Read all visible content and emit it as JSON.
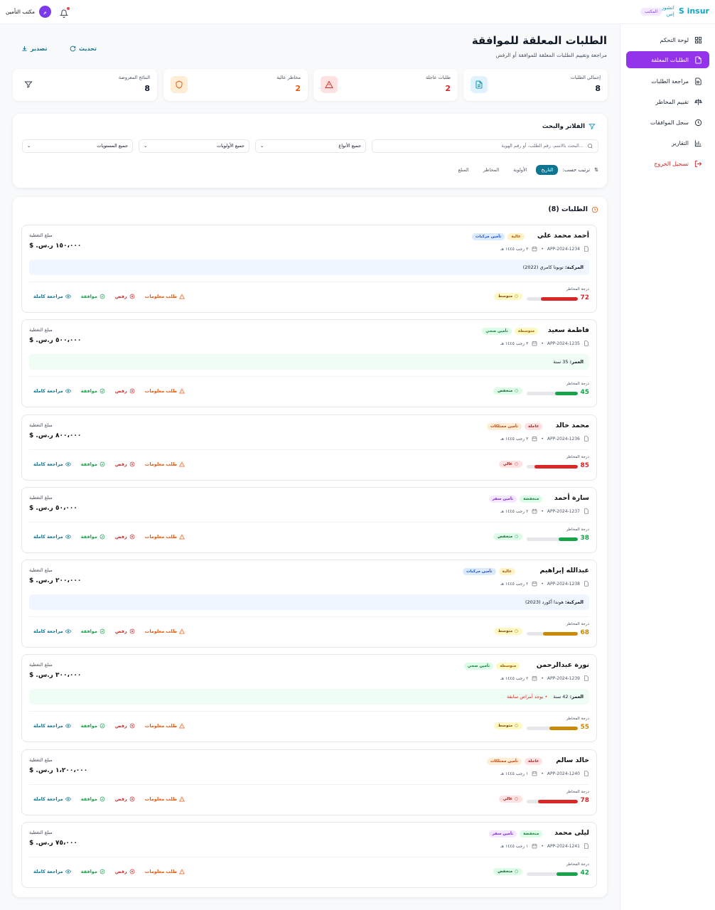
{
  "topbar": {
    "brand_logo": "S insur",
    "brand_name_1": "انشور",
    "brand_name_2": "إس",
    "office_badge": "المكتب",
    "user_name": "مكتب التأمين",
    "avatar_letter": "م"
  },
  "sidebar": {
    "items": [
      {
        "label": "لوحة التحكم",
        "icon": "dashboard-icon"
      },
      {
        "label": "الطلبات المعلقة",
        "icon": "file-icon",
        "active": true
      },
      {
        "label": "مراجعة الطلبات",
        "icon": "review-icon"
      },
      {
        "label": "تقييم المخاطر",
        "icon": "scale-icon"
      },
      {
        "label": "سجل الموافقات",
        "icon": "history-icon"
      },
      {
        "label": "التقارير",
        "icon": "chart-icon"
      },
      {
        "label": "تسجيل الخروج",
        "icon": "logout-icon"
      }
    ]
  },
  "header": {
    "title": "الطلبات المعلقة للموافقة",
    "subtitle": "مراجعة وتقييم الطلبات المعلقة للموافقة أو الرفض",
    "refresh_label": "تحديث",
    "export_label": "تصدير"
  },
  "stats": [
    {
      "label": "إجمالي الطلبات",
      "value": "8",
      "color": "#111827",
      "icon_bg": "#e0f2fe",
      "icon_color": "#0891b2"
    },
    {
      "label": "طلبات عاجلة",
      "value": "2",
      "color": "#dc2626",
      "icon_bg": "#fee2e2",
      "icon_color": "#dc2626"
    },
    {
      "label": "مخاطر عالية",
      "value": "2",
      "color": "#ea580c",
      "icon_bg": "#ffedd5",
      "icon_color": "#ea580c"
    },
    {
      "label": "النتائج المعروضة",
      "value": "8",
      "color": "#111827",
      "icon_bg": "#ffffff",
      "icon_color": "#374151"
    }
  ],
  "filters": {
    "title": "الفلاتر والبحث",
    "search_placeholder": "البحث بالاسم، رقم الطلب، أو رقم الهوية...",
    "type_select": "جميع الأنواع",
    "priority_select": "جميع الأولويات",
    "level_select": "جميع المستويات",
    "sort_label": "ترتيب حسب:",
    "sort_options": [
      "التاريخ",
      "الأولوية",
      "المخاطر",
      "المبلغ"
    ]
  },
  "requests": {
    "title": "الطلبات (8)",
    "coverage_label": "مبلغ التغطية",
    "risk_label": "درجة المخاطر",
    "actions": {
      "info": "طلب معلومات",
      "reject": "رفض",
      "approve": "موافقة",
      "review": "مراجعة كاملة"
    },
    "items": [
      {
        "name": "أحمد محمد علي",
        "priority": "عالية",
        "priority_class": "b-high",
        "type": "تأمين مركبات",
        "type_class": "t-auto",
        "id": "APP-2024-1234",
        "date": "٣ رجب ١٤٤٥ هـ",
        "coverage": "١٥٠،٠٠٠ ر.س.",
        "info_label": "المركبة:",
        "info_value": "تويوتا كامري (2022)",
        "info_style": "blue",
        "risk_score": 72,
        "risk_color": "#dc2626",
        "risk_level": "متوسط",
        "risk_class": "rc-med"
      },
      {
        "name": "فاطمة سعيد",
        "priority": "متوسطة",
        "priority_class": "b-med",
        "type": "تأمين صحي",
        "type_class": "t-health",
        "id": "APP-2024-1235",
        "date": "٣ رجب ١٤٤٥ هـ",
        "coverage": "٥٠٠،٠٠٠ ر.س.",
        "info_label": "العمر:",
        "info_value": "35 سنة",
        "info_style": "green",
        "risk_score": 45,
        "risk_color": "#16a34a",
        "risk_level": "منخفض",
        "risk_class": "rc-low"
      },
      {
        "name": "محمد خالد",
        "priority": "عاجلة",
        "priority_class": "b-urg",
        "type": "تأمين ممتلكات",
        "type_class": "t-prop",
        "id": "APP-2024-1236",
        "date": "٣ رجب ١٤٤٥ هـ",
        "coverage": "٨٠٠،٠٠٠ ر.س.",
        "risk_score": 85,
        "risk_color": "#dc2626",
        "risk_level": "عالي",
        "risk_class": "rc-high"
      },
      {
        "name": "سارة أحمد",
        "priority": "منخفضة",
        "priority_class": "b-low",
        "type": "تأمين سفر",
        "type_class": "t-travel",
        "id": "APP-2024-1237",
        "date": "٢ رجب ١٤٤٥ هـ",
        "coverage": "٥٠،٠٠٠ ر.س.",
        "risk_score": 38,
        "risk_color": "#16a34a",
        "risk_level": "منخفض",
        "risk_class": "rc-low"
      },
      {
        "name": "عبدالله إبراهيم",
        "priority": "عالية",
        "priority_class": "b-high",
        "type": "تأمين مركبات",
        "type_class": "t-auto",
        "id": "APP-2024-1238",
        "date": "٢ رجب ١٤٤٥ هـ",
        "coverage": "٢٠٠،٠٠٠ ر.س.",
        "info_label": "المركبة:",
        "info_value": "هوندا أكورد (2023)",
        "info_style": "blue",
        "risk_score": 68,
        "risk_color": "#ca8a04",
        "risk_level": "متوسط",
        "risk_class": "rc-med"
      },
      {
        "name": "نورة عبدالرحمن",
        "priority": "متوسطة",
        "priority_class": "b-med",
        "type": "تأمين صحي",
        "type_class": "t-health",
        "id": "APP-2024-1239",
        "date": "٢ رجب ١٤٤٥ هـ",
        "coverage": "٣٠٠،٠٠٠ ر.س.",
        "info_label": "العمر:",
        "info_value": "42 سنة",
        "info_warn": "• يوجد أمراض سابقة",
        "info_style": "green",
        "risk_score": 55,
        "risk_color": "#ca8a04",
        "risk_level": "متوسط",
        "risk_class": "rc-med"
      },
      {
        "name": "خالد سالم",
        "priority": "عاجلة",
        "priority_class": "b-urg",
        "type": "تأمين ممتلكات",
        "type_class": "t-prop",
        "id": "APP-2024-1240",
        "date": "١ رجب ١٤٤٥ هـ",
        "coverage": "١،٢٠٠،٠٠٠ ر.س.",
        "risk_score": 78,
        "risk_color": "#dc2626",
        "risk_level": "عالي",
        "risk_class": "rc-high"
      },
      {
        "name": "ليلى محمد",
        "priority": "منخفضة",
        "priority_class": "b-low",
        "type": "تأمين سفر",
        "type_class": "t-travel",
        "id": "APP-2024-1241",
        "date": "١ رجب ١٤٤٥ هـ",
        "coverage": "٧٥،٠٠٠ ر.س.",
        "risk_score": 42,
        "risk_color": "#16a34a",
        "risk_level": "منخفض",
        "risk_class": "rc-low"
      }
    ]
  }
}
